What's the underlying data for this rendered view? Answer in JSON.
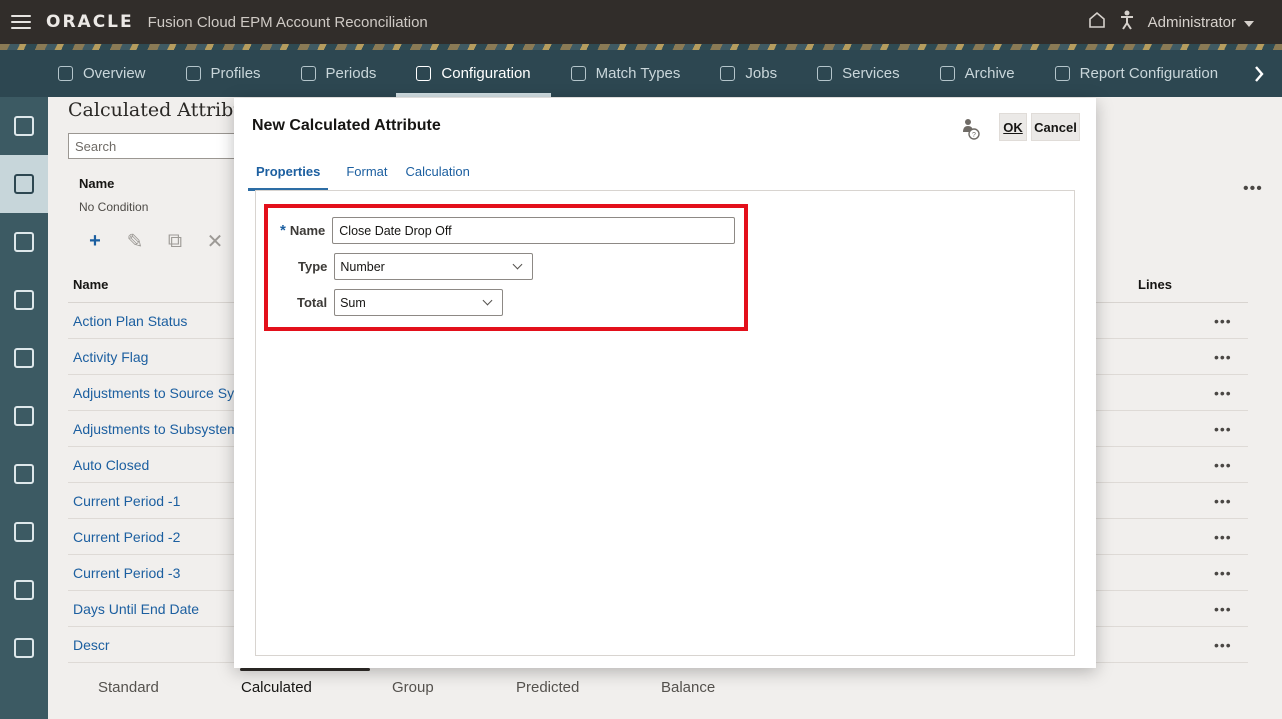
{
  "header": {
    "logo": "ORACLE",
    "app_title": "Fusion Cloud EPM Account Reconciliation",
    "user": "Administrator"
  },
  "nav": {
    "tabs": [
      {
        "label": "Overview",
        "icon": "overview-icon"
      },
      {
        "label": "Profiles",
        "icon": "profiles-icon"
      },
      {
        "label": "Periods",
        "icon": "periods-icon"
      },
      {
        "label": "Configuration",
        "icon": "configuration-icon",
        "active": true
      },
      {
        "label": "Match Types",
        "icon": "match-types-icon"
      },
      {
        "label": "Jobs",
        "icon": "jobs-icon"
      },
      {
        "label": "Services",
        "icon": "services-icon"
      },
      {
        "label": "Archive",
        "icon": "archive-icon"
      },
      {
        "label": "Report Configuration",
        "icon": "report-configuration-icon"
      }
    ]
  },
  "page": {
    "title": "Calculated Attributes",
    "search_placeholder": "Search",
    "filter_label": "Name",
    "filter_value": "No Condition",
    "columns": {
      "name": "Name",
      "lines": "Lines"
    },
    "rows": [
      "Action Plan Status",
      "Activity Flag",
      "Adjustments to Source System",
      "Adjustments to Subsystem",
      "Auto Closed",
      "Current Period -1",
      "Current Period -2",
      "Current Period -3",
      "Days Until End Date",
      "Descr"
    ],
    "bottom_tabs": [
      "Standard",
      "Calculated",
      "Group",
      "Predicted",
      "Balance"
    ],
    "active_bottom_tab": "Calculated"
  },
  "dialog": {
    "title": "New Calculated Attribute",
    "ok_label": "OK",
    "cancel_label": "Cancel",
    "tabs": [
      "Properties",
      "Format",
      "Calculation"
    ],
    "active_tab": "Properties",
    "fields": {
      "name_label": "Name",
      "name_value": "Close Date Drop Off",
      "type_label": "Type",
      "type_value": "Number",
      "total_label": "Total",
      "total_value": "Sum"
    }
  },
  "colors": {
    "header_bg": "#312d2a",
    "nav_bg": "#2d4751",
    "rail_bg": "#3c5a63",
    "link": "#1c5fa0",
    "highlight": "#e3101b"
  }
}
